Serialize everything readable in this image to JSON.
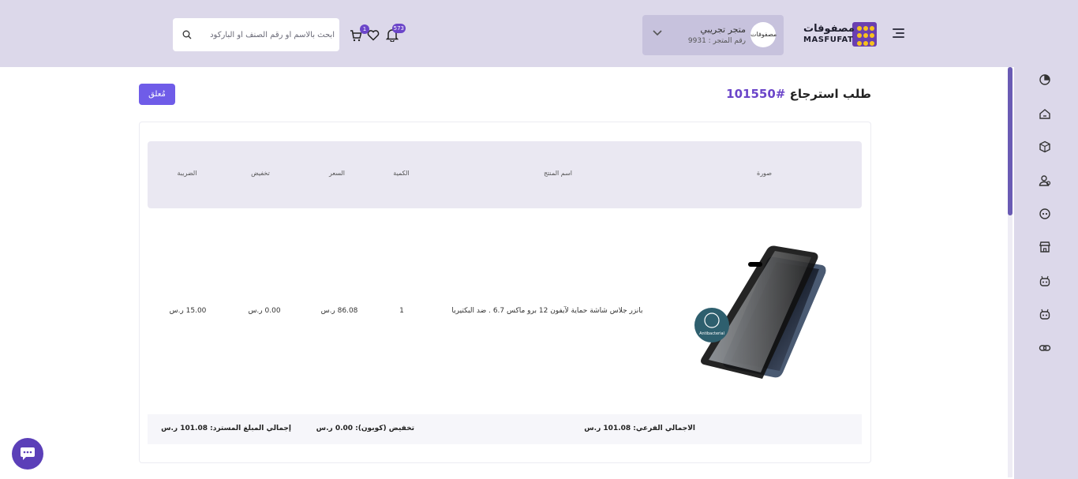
{
  "header": {
    "logo_ar": "مصفوفات",
    "logo_en": "MASFUFAT",
    "store": {
      "name": "متجر تجريبي",
      "number": "رقم المتجر : 9931",
      "avatar_text": "مصفوفات"
    },
    "notifications_count": "573",
    "cart_count": "1",
    "search": {
      "placeholder": "ابحث بالاسم أو رقم الصنف أو الباركود"
    }
  },
  "page": {
    "title": "طلب استرجاع",
    "order_number": "#101550",
    "status_label": "مُعلق"
  },
  "table": {
    "headers": [
      "صورة",
      "اسم المنتج",
      "الكمية",
      "السعر",
      "تخفيض",
      "الضريبة"
    ],
    "rows": [
      {
        "product_name": "بانزر جلاس شاشة حماية لآيفون 12 برو ماكس 6.7 .  ضد  البكتيريا",
        "quantity": "1",
        "price": "86.08 ر.س",
        "discount": "0.00 ر.س",
        "tax": "15.00 ر.س",
        "image_badge": "Antibacterial"
      }
    ]
  },
  "totals": {
    "subtotal": "الاجمالي الفرعي: 101.08 ر.س",
    "coupon_discount": "تخفيض (كوبون): 0.00 ر.س",
    "refund_total": "إجمالي المبلغ المسترد: 101.08 ر.س"
  },
  "colors": {
    "accent": "#6b45c9",
    "button": "#6f5ce8",
    "header_bg": "#dcd8ea",
    "logo_bg": "#6a3fb0",
    "logo_dots": "#f7c21c"
  },
  "rail_icons": [
    "pie-chart-icon",
    "home-icon",
    "box-icon",
    "users-icon",
    "sales-icon",
    "store-icon",
    "robot-icon",
    "bot-icon",
    "link-icon"
  ]
}
